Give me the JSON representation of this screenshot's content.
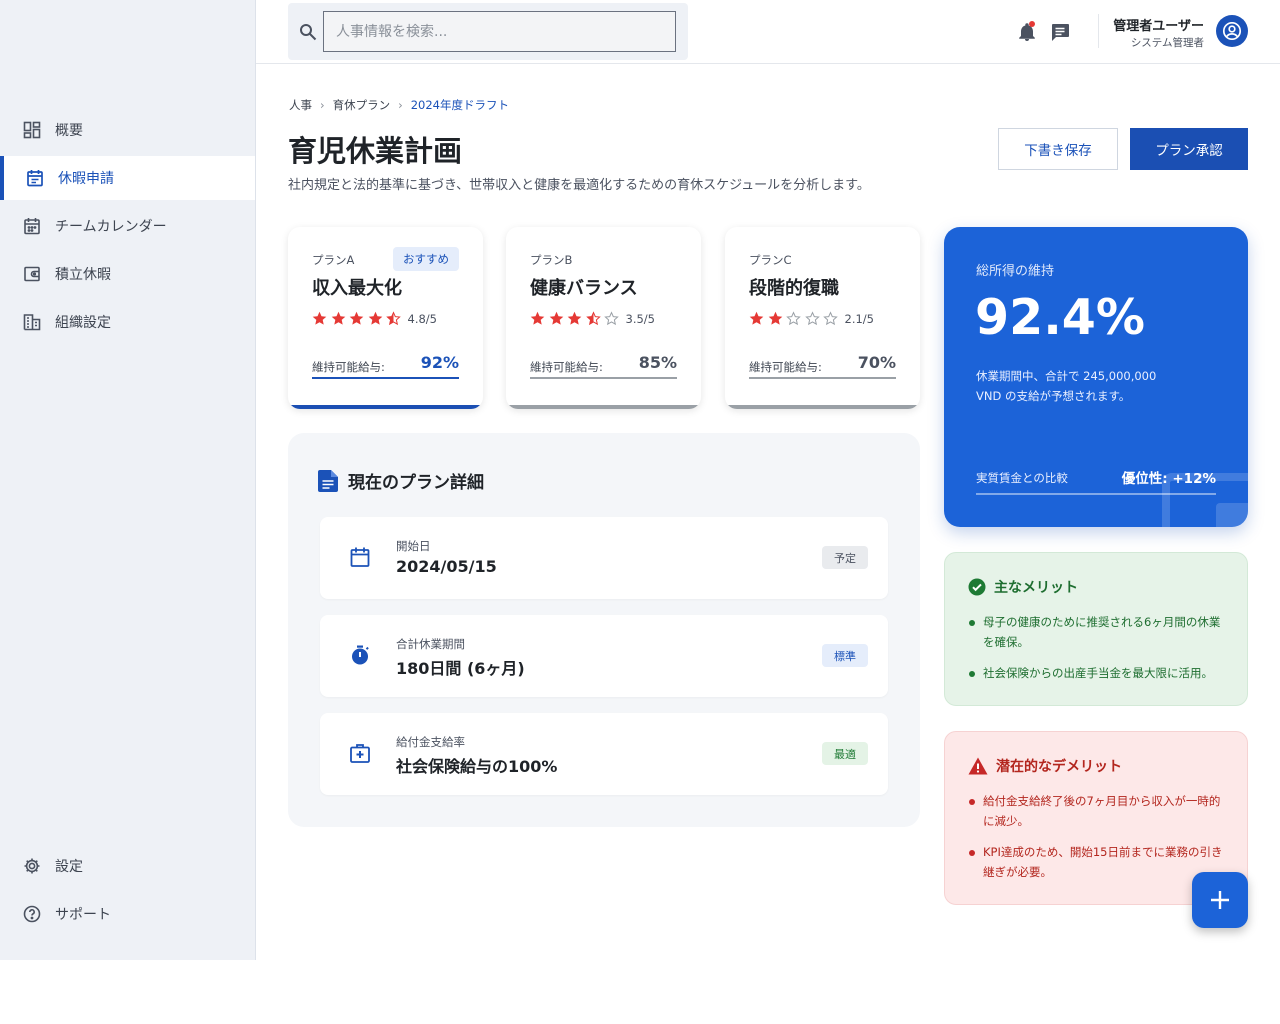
{
  "search": {
    "placeholder": "人事情報を検索..."
  },
  "user": {
    "name": "管理者ユーザー",
    "role": "システム管理者"
  },
  "sidebar": {
    "items": [
      {
        "label": "概要",
        "icon": "dashboard-icon"
      },
      {
        "label": "休暇申請",
        "icon": "calendar-event-icon",
        "active": true
      },
      {
        "label": "チームカレンダー",
        "icon": "calendar-icon"
      },
      {
        "label": "積立休暇",
        "icon": "wallet-icon"
      },
      {
        "label": "組織設定",
        "icon": "building-icon"
      }
    ],
    "bottom": [
      {
        "label": "設定",
        "icon": "gear-icon"
      },
      {
        "label": "サポート",
        "icon": "help-icon"
      }
    ]
  },
  "breadcrumb": [
    "人事",
    "育休プラン",
    "2024年度ドラフト"
  ],
  "header": {
    "title": "育児休業計画",
    "subtitle": "社内規定と法的基準に基づき、世帯収入と健康を最適化するための育休スケジュールを分析します。",
    "save_draft_label": "下書き保存",
    "approve_label": "プラン承認"
  },
  "plans": [
    {
      "label": "プランA",
      "badge": "おすすめ",
      "name": "収入最大化",
      "stars": 4.5,
      "rating": "4.8/5",
      "retain_label": "維持可能給与:",
      "retain_value": "92%",
      "selected": true
    },
    {
      "label": "プランB",
      "name": "健康バランス",
      "stars": 3.5,
      "rating": "3.5/5",
      "retain_label": "維持可能給与:",
      "retain_value": "85%",
      "selected": false
    },
    {
      "label": "プランC",
      "name": "段階的復職",
      "stars": 2,
      "rating": "2.1/5",
      "retain_label": "維持可能給与:",
      "retain_value": "70%",
      "selected": false
    }
  ],
  "details": {
    "title": "現在のプラン詳細",
    "rows": [
      {
        "icon": "calendar-icon",
        "label": "開始日",
        "value": "2024/05/15",
        "badge": "予定",
        "badge_tone": "gray"
      },
      {
        "icon": "timer-icon",
        "label": "合計休業期間",
        "value": "180日間 (6ヶ月)",
        "badge": "標準",
        "badge_tone": "blue"
      },
      {
        "icon": "medical-bag-icon",
        "label": "給付金支給率",
        "value": "社会保険給与の100%",
        "badge": "最適",
        "badge_tone": "green"
      }
    ]
  },
  "income": {
    "label": "総所得の維持",
    "value": "92.4%",
    "desc": "休業期間中、合計で 245,000,000 VND の支給が予想されます。",
    "compare_label": "実質賃金との比較",
    "compare_value": "優位性: +12%"
  },
  "merits": {
    "title": "主なメリット",
    "items": [
      "母子の健康のために推奨される6ヶ月間の休業を確保。",
      "社会保険からの出産手当金を最大限に活用。"
    ]
  },
  "demerits": {
    "title": "潜在的なデメリット",
    "items": [
      "給付金支給終了後の7ヶ月目から収入が一時的に減少。",
      "KPI達成のため、開始15日前までに業務の引き継ぎが必要。"
    ]
  },
  "colors": {
    "primary": "#1b52b8",
    "accent_blue": "#1c63d8",
    "star": "#e53935",
    "success": "#1e7a34",
    "danger": "#b3261e"
  }
}
